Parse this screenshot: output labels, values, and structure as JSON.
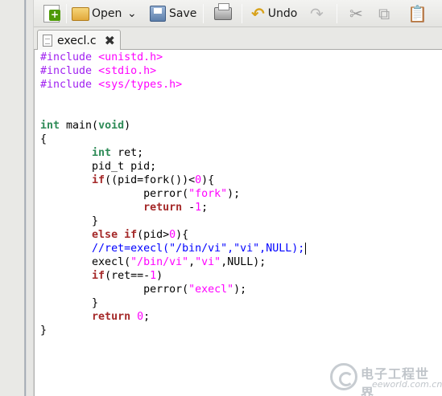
{
  "toolbar": {
    "open_label": "Open",
    "save_label": "Save",
    "undo_label": "Undo"
  },
  "tab": {
    "filename": "execl.c"
  },
  "code_lines": [
    [
      {
        "t": "#include ",
        "c": "pp"
      },
      {
        "t": "<unistd.h>",
        "c": "str"
      }
    ],
    [
      {
        "t": "#include ",
        "c": "pp"
      },
      {
        "t": "<stdio.h>",
        "c": "str"
      }
    ],
    [
      {
        "t": "#include ",
        "c": "pp"
      },
      {
        "t": "<sys/types.h>",
        "c": "str"
      }
    ],
    [],
    [],
    [
      {
        "t": "int",
        "c": "ty"
      },
      {
        "t": " main(",
        "c": ""
      },
      {
        "t": "void",
        "c": "ty"
      },
      {
        "t": ")",
        "c": ""
      }
    ],
    [
      {
        "t": "{",
        "c": ""
      }
    ],
    [
      {
        "t": "        ",
        "c": ""
      },
      {
        "t": "int",
        "c": "ty"
      },
      {
        "t": " ret;",
        "c": ""
      }
    ],
    [
      {
        "t": "        pid_t pid;",
        "c": ""
      }
    ],
    [
      {
        "t": "        ",
        "c": ""
      },
      {
        "t": "if",
        "c": "kw"
      },
      {
        "t": "((pid=fork())<",
        "c": ""
      },
      {
        "t": "0",
        "c": "num"
      },
      {
        "t": "){",
        "c": ""
      }
    ],
    [
      {
        "t": "                perror(",
        "c": ""
      },
      {
        "t": "\"fork\"",
        "c": "str"
      },
      {
        "t": ");",
        "c": ""
      }
    ],
    [
      {
        "t": "                ",
        "c": ""
      },
      {
        "t": "return",
        "c": "kw"
      },
      {
        "t": " -",
        "c": ""
      },
      {
        "t": "1",
        "c": "num"
      },
      {
        "t": ";",
        "c": ""
      }
    ],
    [
      {
        "t": "        }",
        "c": ""
      }
    ],
    [
      {
        "t": "        ",
        "c": ""
      },
      {
        "t": "else",
        "c": "kw"
      },
      {
        "t": " ",
        "c": ""
      },
      {
        "t": "if",
        "c": "kw"
      },
      {
        "t": "(pid>",
        "c": ""
      },
      {
        "t": "0",
        "c": "num"
      },
      {
        "t": "){",
        "c": ""
      }
    ],
    [
      {
        "t": "        ",
        "c": ""
      },
      {
        "t": "//ret=execl(\"/bin/vi\",\"vi\",NULL);",
        "c": "cm"
      },
      {
        "t": "",
        "c": "caret"
      }
    ],
    [
      {
        "t": "        execl(",
        "c": ""
      },
      {
        "t": "\"/bin/vi\"",
        "c": "str"
      },
      {
        "t": ",",
        "c": ""
      },
      {
        "t": "\"vi\"",
        "c": "str"
      },
      {
        "t": ",NULL);",
        "c": ""
      }
    ],
    [
      {
        "t": "        ",
        "c": ""
      },
      {
        "t": "if",
        "c": "kw"
      },
      {
        "t": "(ret==-",
        "c": ""
      },
      {
        "t": "1",
        "c": "num"
      },
      {
        "t": ")",
        "c": ""
      }
    ],
    [
      {
        "t": "                perror(",
        "c": ""
      },
      {
        "t": "\"execl\"",
        "c": "str"
      },
      {
        "t": ");",
        "c": ""
      }
    ],
    [
      {
        "t": "        }",
        "c": ""
      }
    ],
    [
      {
        "t": "        ",
        "c": ""
      },
      {
        "t": "return",
        "c": "kw"
      },
      {
        "t": " ",
        "c": ""
      },
      {
        "t": "0",
        "c": "num"
      },
      {
        "t": ";",
        "c": ""
      }
    ],
    [
      {
        "t": "}",
        "c": ""
      }
    ]
  ],
  "watermark": {
    "cn": "电子工程世界",
    "en": "eeworld.com.cn"
  }
}
